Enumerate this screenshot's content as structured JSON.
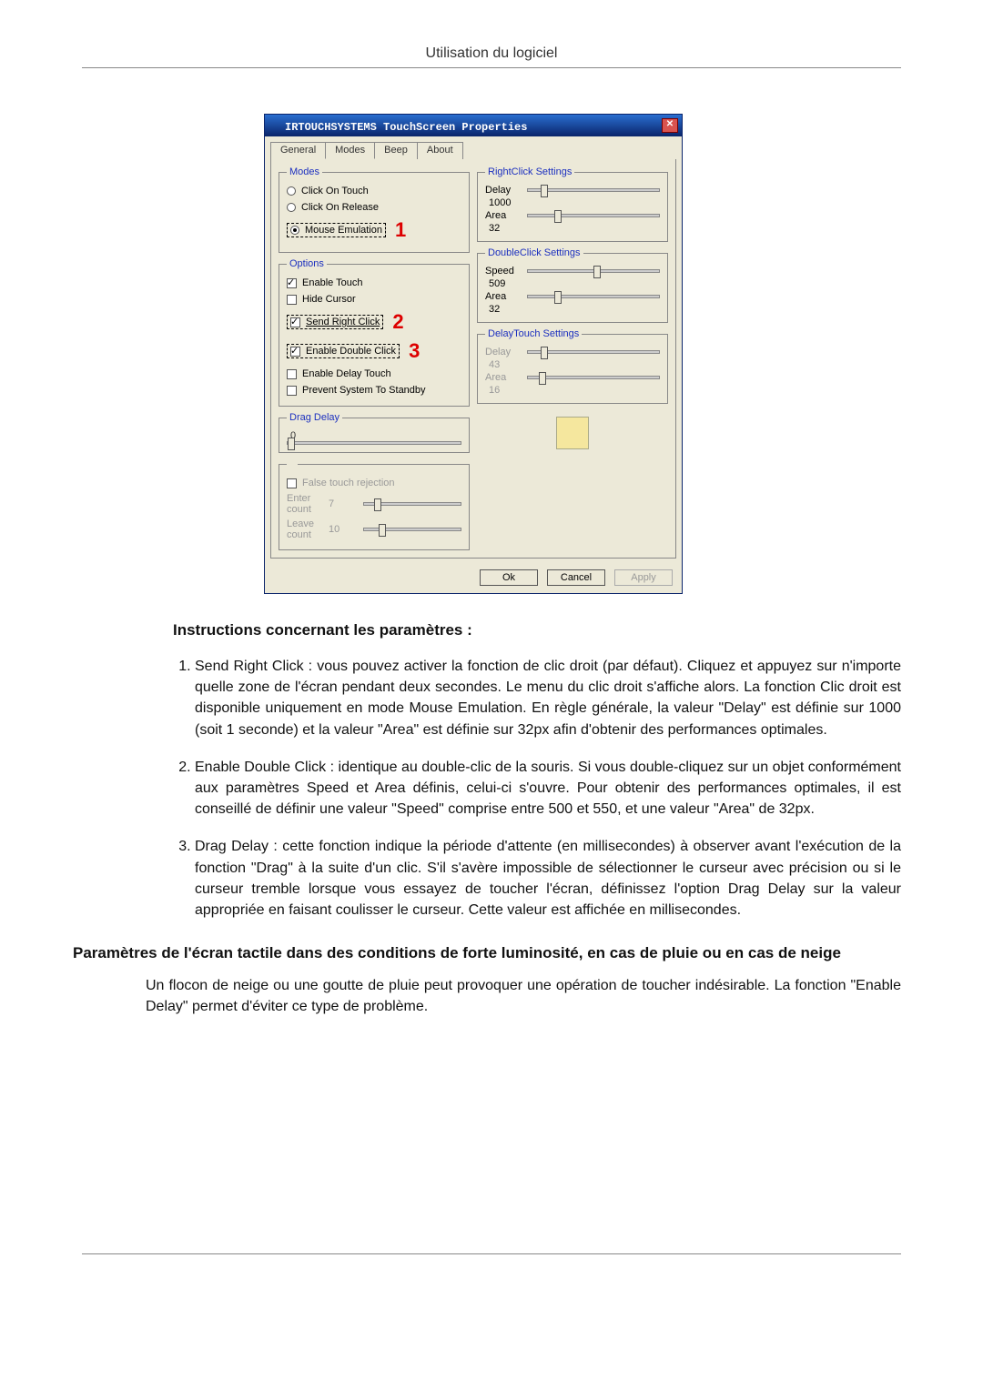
{
  "header": {
    "title": "Utilisation du logiciel"
  },
  "dialog": {
    "title": "IRTOUCHSYSTEMS TouchScreen Properties",
    "tabs": [
      "General",
      "Modes",
      "Beep",
      "About"
    ],
    "active_tab": 1,
    "modes": {
      "legend": "Modes",
      "click_on_touch": "Click On Touch",
      "click_on_release": "Click On Release",
      "mouse_emulation": "Mouse Emulation"
    },
    "options": {
      "legend": "Options",
      "enable_touch": "Enable Touch",
      "hide_cursor": "Hide Cursor",
      "send_right_click": "Send Right Click",
      "enable_double_click": "Enable Double Click",
      "enable_delay_touch": "Enable Delay Touch",
      "prevent_standby": "Prevent System To Standby"
    },
    "drag_delay": {
      "legend": "Drag Delay",
      "value": "0"
    },
    "false_touch": {
      "label": "False touch rejection",
      "enter_label": "Enter count",
      "enter_value": "7",
      "leave_label": "Leave count",
      "leave_value": "10"
    },
    "right_click": {
      "legend": "RightClick Settings",
      "delay_label": "Delay",
      "delay_value": "1000",
      "area_label": "Area",
      "area_value": "32"
    },
    "double_click": {
      "legend": "DoubleClick Settings",
      "speed_label": "Speed",
      "speed_value": "509",
      "area_label": "Area",
      "area_value": "32"
    },
    "delay_touch": {
      "legend": "DelayTouch Settings",
      "delay_label": "Delay",
      "delay_value": "43",
      "area_label": "Area",
      "area_value": "16"
    },
    "annotations": {
      "a1": "1",
      "a2": "2",
      "a3": "3"
    },
    "buttons": {
      "ok": "Ok",
      "cancel": "Cancel",
      "apply": "Apply"
    }
  },
  "doc": {
    "instructions_heading": "Instructions concernant les paramètres :",
    "items": [
      "Send Right Click : vous pouvez activer la fonction de clic droit (par défaut). Cliquez et appuyez sur n'importe quelle zone de l'écran pendant deux secondes. Le menu du clic droit s'affiche alors. La fonction Clic droit est disponible uniquement en mode Mouse Emulation. En règle générale, la valeur \"Delay\" est définie sur 1000 (soit 1 seconde) et la valeur \"Area\" est définie sur 32px afin d'obtenir des performances optimales.",
      "Enable Double Click : identique au double-clic de la souris. Si vous double-cliquez sur un objet conformément aux paramètres Speed et Area définis, celui-ci s'ouvre. Pour obtenir des performances optimales, il est conseillé de définir une valeur \"Speed\" comprise entre 500 et 550, et une valeur \"Area\" de 32px.",
      "Drag Delay : cette fonction indique la période d'attente (en millisecondes) à observer avant l'exécution de la fonction \"Drag\" à la suite d'un clic. S'il s'avère impossible de sélectionner le curseur avec précision ou si le curseur tremble lorsque vous essayez de toucher l'écran, définissez l'option Drag Delay sur la valeur appropriée en faisant coulisser le curseur. Cette valeur est affichée en millisecondes."
    ],
    "sub_heading": "Paramètres de l'écran tactile dans des conditions de forte luminosité, en cas de pluie ou en cas de neige",
    "sub_para": "Un flocon de neige ou une goutte de pluie peut provoquer une opération de toucher indésirable. La fonction \"Enable Delay\" permet d'éviter ce type de problème."
  }
}
